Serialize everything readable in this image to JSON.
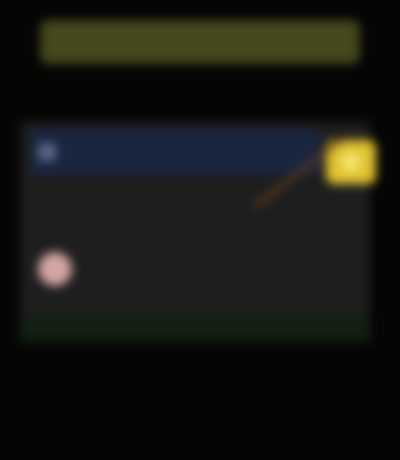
{
  "banner": {
    "title": ""
  },
  "subtitle": {
    "text": ""
  },
  "search": {
    "text": ""
  },
  "section": {
    "label": ""
  },
  "user": {
    "name": ""
  },
  "footer": {
    "text": ""
  },
  "icons": {
    "search": "search-icon",
    "badge": "notification-icon",
    "avatar": "avatar-icon",
    "arrow": "arrow-indicator"
  },
  "colors": {
    "banner": "#45471c",
    "accent": "#e1c230",
    "search_field": "#1a2540",
    "panel": "#1e1e1e",
    "arrow": "#6a3e1c",
    "avatar": "#d3a5a2"
  }
}
